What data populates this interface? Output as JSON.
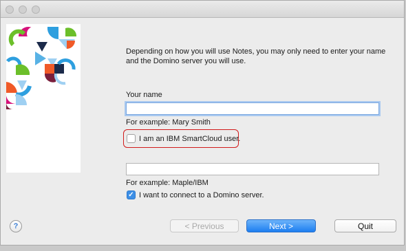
{
  "window": {
    "title": ""
  },
  "intro_text": "Depending on how you will use Notes, you may only need to enter your name and the Domino server you will use.",
  "name_section": {
    "label": "Your name",
    "value": "",
    "example": "For example: Mary Smith"
  },
  "smartcloud": {
    "label": "I am an IBM SmartCloud user.",
    "checked": false
  },
  "server_section": {
    "value": "",
    "example": "For example: Maple/IBM"
  },
  "domino": {
    "label": "I want to connect to a Domino server.",
    "checked": true,
    "check_glyph": "✓"
  },
  "help": {
    "glyph": "?"
  },
  "buttons": {
    "previous": "< Previous",
    "next": "Next >",
    "quit": "Quit"
  },
  "colors": {
    "accent_blue": "#1d7ef0",
    "highlight_red": "#d11a1a",
    "art_palette": [
      "#d6117a",
      "#6cbf2a",
      "#2e9fdf",
      "#f05a28",
      "#7a1f3c",
      "#9fd0f2",
      "#1b2a4a"
    ]
  }
}
